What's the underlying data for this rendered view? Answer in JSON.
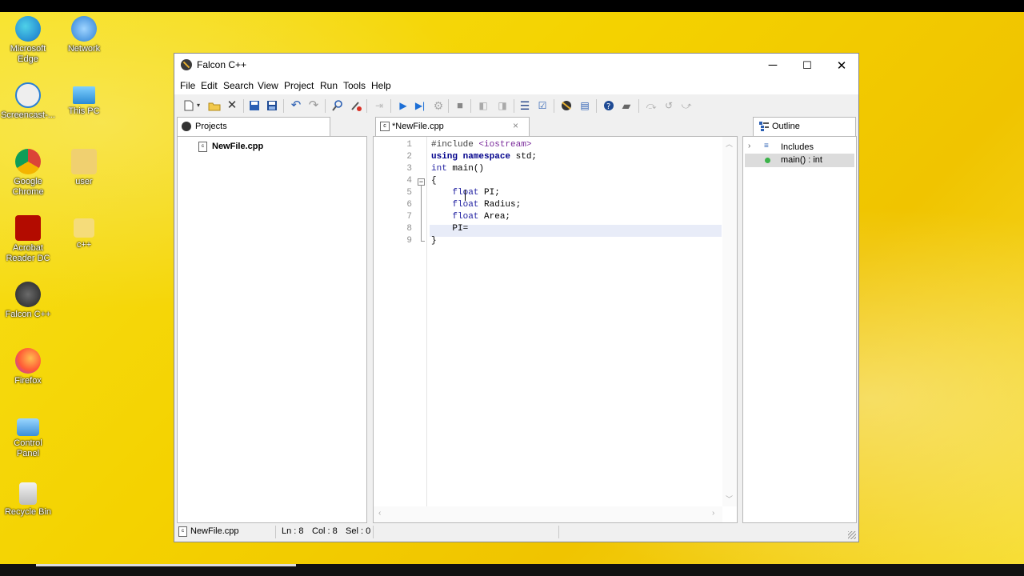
{
  "desktop": {
    "icons": [
      {
        "label_line1": "Microsoft",
        "label_line2": "Edge",
        "icon": "edge-icon"
      },
      {
        "label_line1": "Network",
        "label_line2": "",
        "icon": "network-icon"
      },
      {
        "label_line1": "Screencast-...",
        "label_line2": "",
        "icon": "screencast-icon"
      },
      {
        "label_line1": "This PC",
        "label_line2": "",
        "icon": "this-pc-icon"
      },
      {
        "label_line1": "Google",
        "label_line2": "Chrome",
        "icon": "chrome-icon"
      },
      {
        "label_line1": "user",
        "label_line2": "",
        "icon": "user-folder-icon"
      },
      {
        "label_line1": "Acrobat",
        "label_line2": "Reader DC",
        "icon": "acrobat-icon"
      },
      {
        "label_line1": "c++",
        "label_line2": "",
        "icon": "folder-icon"
      },
      {
        "label_line1": "Falcon C++",
        "label_line2": "",
        "icon": "falcon-icon"
      },
      {
        "label_line1": "Firefox",
        "label_line2": "",
        "icon": "firefox-icon"
      },
      {
        "label_line1": "Control",
        "label_line2": "Panel",
        "icon": "control-panel-icon"
      },
      {
        "label_line1": "Recycle Bin",
        "label_line2": "",
        "icon": "recycle-bin-icon"
      }
    ]
  },
  "window": {
    "title": "Falcon C++",
    "minimize": "─",
    "maximize": "☐",
    "close": "✕"
  },
  "menu": [
    "File",
    "Edit",
    "Search",
    "View",
    "Project",
    "Run",
    "Tools",
    "Help"
  ],
  "projects_panel": {
    "tab_label": "Projects",
    "file": "NewFile.cpp"
  },
  "editor": {
    "tab_label": "*NewFile.cpp",
    "tab_close": "×",
    "line_numbers": [
      "1",
      "2",
      "3",
      "4",
      "5",
      "6",
      "7",
      "8",
      "9"
    ],
    "lines": [
      {
        "a": "#include ",
        "b": "<iostream>",
        "c": ""
      },
      {
        "a": "using namespace",
        "b": " std;",
        "c": ""
      },
      {
        "a": "int",
        "b": " main()",
        "c": ""
      },
      {
        "a": "{",
        "b": "",
        "c": ""
      },
      {
        "a": "    float",
        "b": " PI;",
        "c": ""
      },
      {
        "a": "    float",
        "b": " Radius;",
        "c": ""
      },
      {
        "a": "    float",
        "b": " Area;",
        "c": ""
      },
      {
        "a": "    PI=",
        "b": "",
        "c": ""
      },
      {
        "a": "}",
        "b": "",
        "c": ""
      }
    ]
  },
  "outline_panel": {
    "tab_label": "Outline",
    "items": [
      {
        "label": "Includes"
      },
      {
        "label": "main() : int"
      }
    ]
  },
  "status": {
    "file": "NewFile.cpp",
    "ln": "Ln : 8",
    "col": "Col : 8",
    "sel": "Sel : 0"
  },
  "colors": {
    "desktop_yellow": "#f4d200",
    "current_line": "#e8ecf8",
    "selected_outline": "#dcdcdc"
  }
}
